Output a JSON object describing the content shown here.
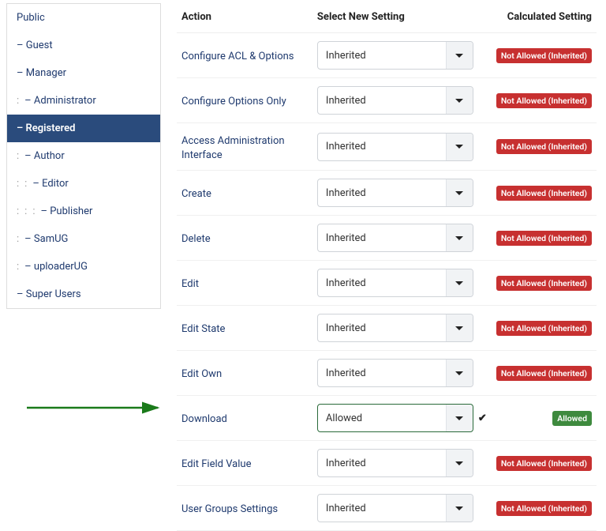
{
  "sidebar": {
    "items": [
      {
        "label": "Public",
        "depth": 0,
        "active": false
      },
      {
        "label": "– Guest",
        "depth": 0,
        "active": false
      },
      {
        "label": "– Manager",
        "depth": 0,
        "active": false
      },
      {
        "label": "– Administrator",
        "depth": 1,
        "active": false
      },
      {
        "label": "– Registered",
        "depth": 0,
        "active": true
      },
      {
        "label": "– Author",
        "depth": 1,
        "active": false
      },
      {
        "label": "– Editor",
        "depth": 2,
        "active": false
      },
      {
        "label": "– Publisher",
        "depth": 3,
        "active": false
      },
      {
        "label": "– SamUG",
        "depth": 1,
        "active": false
      },
      {
        "label": "– uploaderUG",
        "depth": 1,
        "active": false
      },
      {
        "label": "– Super Users",
        "depth": 0,
        "active": false
      }
    ]
  },
  "headers": {
    "action": "Action",
    "select": "Select New Setting",
    "calc": "Calculated Setting"
  },
  "badges": {
    "not_allowed_inherited": "Not Allowed (Inherited)",
    "allowed": "Allowed"
  },
  "rows": [
    {
      "action": "Configure ACL & Options",
      "setting": "Inherited",
      "calc": "not_allowed_inherited",
      "changed": false
    },
    {
      "action": "Configure Options Only",
      "setting": "Inherited",
      "calc": "not_allowed_inherited",
      "changed": false
    },
    {
      "action": "Access Administration Interface",
      "setting": "Inherited",
      "calc": "not_allowed_inherited",
      "changed": false
    },
    {
      "action": "Create",
      "setting": "Inherited",
      "calc": "not_allowed_inherited",
      "changed": false
    },
    {
      "action": "Delete",
      "setting": "Inherited",
      "calc": "not_allowed_inherited",
      "changed": false
    },
    {
      "action": "Edit",
      "setting": "Inherited",
      "calc": "not_allowed_inherited",
      "changed": false
    },
    {
      "action": "Edit State",
      "setting": "Inherited",
      "calc": "not_allowed_inherited",
      "changed": false
    },
    {
      "action": "Edit Own",
      "setting": "Inherited",
      "calc": "not_allowed_inherited",
      "changed": false
    },
    {
      "action": "Download",
      "setting": "Allowed",
      "calc": "allowed",
      "changed": true
    },
    {
      "action": "Edit Field Value",
      "setting": "Inherited",
      "calc": "not_allowed_inherited",
      "changed": false
    },
    {
      "action": "User Groups Settings",
      "setting": "Inherited",
      "calc": "not_allowed_inherited",
      "changed": false
    }
  ],
  "colors": {
    "sidebar_active_bg": "#2a4b7c",
    "link": "#1f3a6e",
    "badge_red": "#c73030",
    "badge_green": "#3e8a3e"
  }
}
